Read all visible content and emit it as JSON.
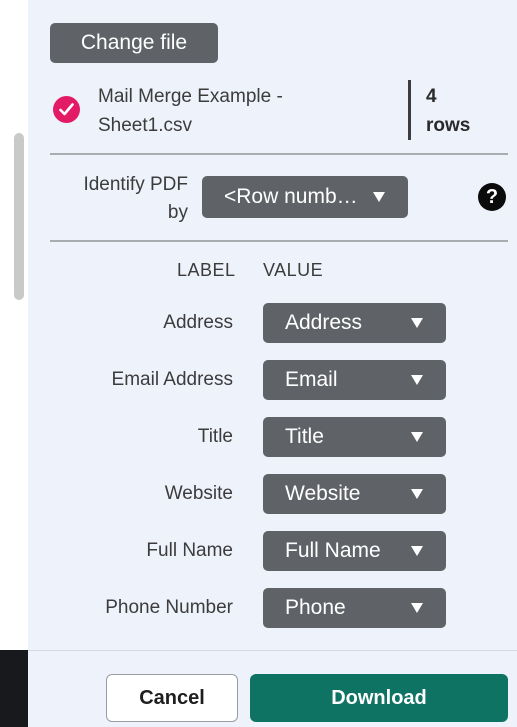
{
  "panel": {
    "change_file_label": "Change file",
    "file": {
      "name_line1": "Mail Merge Example -",
      "name_line2": "Sheet1.csv",
      "rows_count": "4",
      "rows_label": "rows"
    },
    "identify": {
      "label_line1": "Identify PDF",
      "label_line2": "by",
      "selected_value": "<Row numb…",
      "help_symbol": "?"
    },
    "columns": {
      "label_header": "LABEL",
      "value_header": "VALUE"
    },
    "mappings": [
      {
        "label": "Address",
        "value": "Address"
      },
      {
        "label": "Email Address",
        "value": "Email"
      },
      {
        "label": "Title",
        "value": "Title"
      },
      {
        "label": "Website",
        "value": "Website"
      },
      {
        "label": "Full Name",
        "value": "Full Name"
      },
      {
        "label": "Phone Number",
        "value": "Phone"
      }
    ]
  },
  "footer": {
    "cancel_label": "Cancel",
    "download_label": "Download"
  },
  "colors": {
    "panel_bg": "#eef2fb",
    "select_bg": "#5f6368",
    "check_accent": "#e31b66",
    "download_bg": "#0f7364"
  },
  "icons": {
    "check": "check-circle-icon",
    "help": "help-circle-icon",
    "dropdown": "caret-down-icon"
  }
}
